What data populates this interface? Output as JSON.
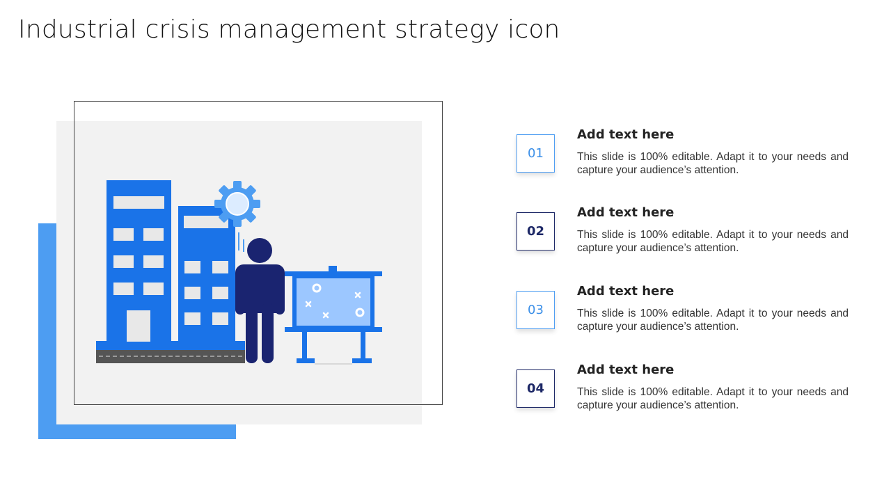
{
  "slide": {
    "title": "Industrial crisis management strategy icon"
  },
  "colors": {
    "accent_light": "#4d9df2",
    "accent_dark": "#1c2766",
    "building_blue": "#1a73e8",
    "panel_grey": "#f2f2f2"
  },
  "illustration": {
    "icons": [
      "building-icon",
      "gear-icon",
      "person-icon",
      "presentation-board-icon",
      "road-icon"
    ]
  },
  "items": [
    {
      "number": "01",
      "heading": "Add text here",
      "text": "This slide is 100% editable. Adapt it to your needs and capture your audience’s attention."
    },
    {
      "number": "02",
      "heading": "Add text here",
      "text": "This slide is 100% editable. Adapt it to your needs and capture your audience’s attention."
    },
    {
      "number": "03",
      "heading": "Add text here",
      "text": "This slide is 100% editable. Adapt it to your needs and capture your audience’s attention."
    },
    {
      "number": "04",
      "heading": "Add text here",
      "text": "This slide is 100% editable. Adapt it to your needs and capture your audience’s attention."
    }
  ]
}
